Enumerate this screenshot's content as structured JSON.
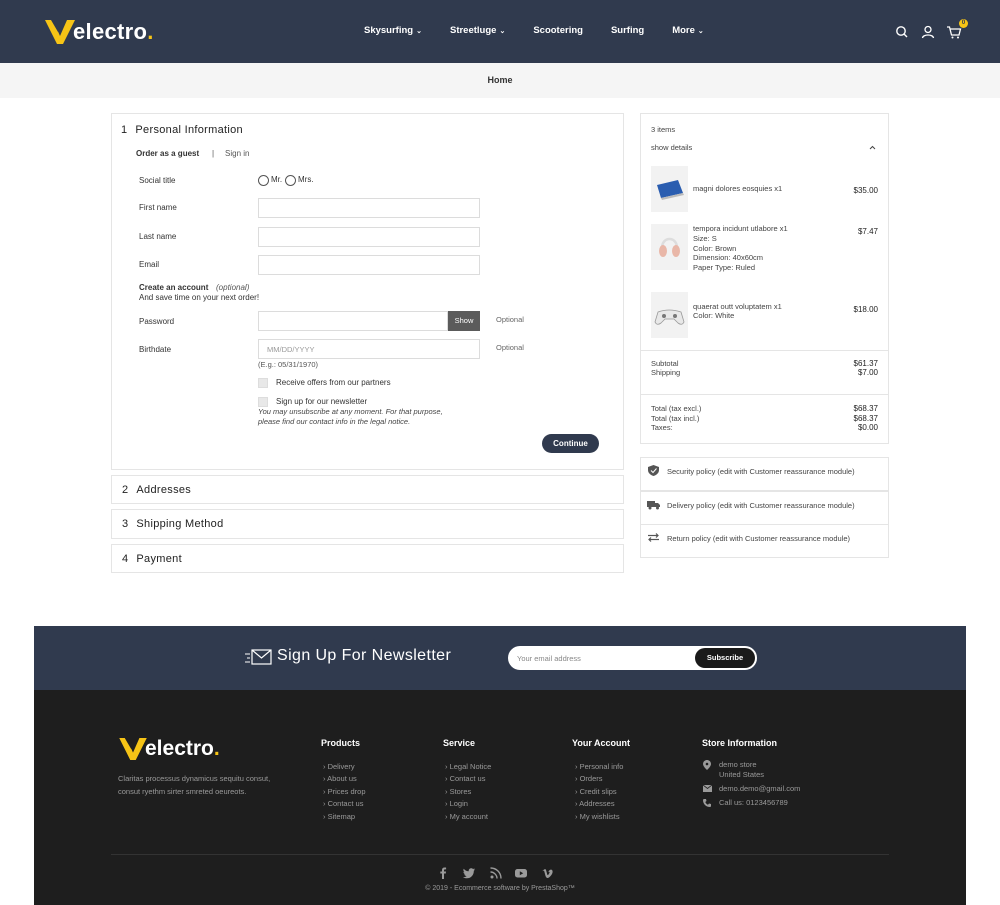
{
  "brand": {
    "name": "electro",
    "dot": "."
  },
  "nav": {
    "items": [
      {
        "label": "Skysurfing",
        "chevron": "⌄"
      },
      {
        "label": "Streetluge",
        "chevron": "⌄"
      },
      {
        "label": "Scootering",
        "chevron": ""
      },
      {
        "label": "Surfing",
        "chevron": ""
      },
      {
        "label": "More",
        "chevron": "⌄"
      }
    ],
    "cart_count": "0"
  },
  "breadcrumb": {
    "home": "Home"
  },
  "checkout": {
    "step1": {
      "number": "1",
      "title": "Personal Information",
      "tab_guest": "Order as a guest",
      "tab_sep": "|",
      "tab_signin": "Sign in",
      "social_title_label": "Social title",
      "mr": "Mr.",
      "mrs": "Mrs.",
      "first_name_label": "First name",
      "last_name_label": "Last name",
      "email_label": "Email",
      "create_account": "Create an account",
      "create_optional": "(optional)",
      "save_time": "And save time on your next order!",
      "password_label": "Password",
      "show_label": "Show",
      "password_optional": "Optional",
      "birthdate_label": "Birthdate",
      "birthdate_placeholder": "MM/DD/YYYY",
      "birthdate_optional": "Optional",
      "birthdate_example": "(E.g.: 05/31/1970)",
      "offers_label": "Receive offers from our partners",
      "newsletter_label": "Sign up for our newsletter",
      "newsletter_note_1": "You may unsubscribe at any moment. For that purpose,",
      "newsletter_note_2": "please find our contact info in the legal notice.",
      "continue": "Continue"
    },
    "step2": {
      "number": "2",
      "title": "Addresses"
    },
    "step3": {
      "number": "3",
      "title": "Shipping Method"
    },
    "step4": {
      "number": "4",
      "title": "Payment"
    }
  },
  "cart": {
    "items_count": "3 items",
    "show_details": "show details",
    "items": [
      {
        "name": "magni dolores eosquies x1",
        "price": "$35.00",
        "attrs": []
      },
      {
        "name": "tempora incidunt utlabore x1",
        "price": "$7.47",
        "attrs": [
          "Size: S",
          "Color: Brown",
          "Dimension: 40x60cm",
          "Paper Type: Ruled"
        ]
      },
      {
        "name": "quaerat outt voluptatem x1",
        "price": "$18.00",
        "attrs": [
          "Color: White"
        ]
      }
    ],
    "subtotal_label": "Subtotal",
    "subtotal_value": "$61.37",
    "shipping_label": "Shipping",
    "shipping_value": "$7.00",
    "total_excl_label": "Total (tax excl.)",
    "total_excl_value": "$68.37",
    "total_incl_label": "Total (tax incl.)",
    "total_incl_value": "$68.37",
    "taxes_label": "Taxes:",
    "taxes_value": "$0.00"
  },
  "reassurance": [
    {
      "icon": "shield-icon",
      "text": "Security policy (edit with Customer reassurance module)"
    },
    {
      "icon": "truck-icon",
      "text": "Delivery policy (edit with Customer reassurance module)"
    },
    {
      "icon": "swap-arrows-icon",
      "text": "Return policy (edit with Customer reassurance module)"
    }
  ],
  "newsletter": {
    "title": "Sign Up For Newsletter",
    "placeholder": "Your email address",
    "button": "Subscribe"
  },
  "footer": {
    "description": "Claritas processus dynamicus sequitu consut, consut ryethm sirter smreted oeureots.",
    "products": {
      "title": "Products",
      "links": [
        "Delivery",
        "About us",
        "Prices drop",
        "Contact us",
        "Sitemap"
      ]
    },
    "service": {
      "title": "Service",
      "links": [
        "Legal Notice",
        "Contact us",
        "Stores",
        "Login",
        "My account"
      ]
    },
    "account": {
      "title": "Your Account",
      "links": [
        "Personal info",
        "Orders",
        "Credit slips",
        "Addresses",
        "My wishlists"
      ]
    },
    "store": {
      "title": "Store Information",
      "address_1": "demo store",
      "address_2": "United States",
      "email": "demo.demo@gmail.com",
      "call": "Call us: 0123456789"
    },
    "social": [
      "facebook-icon",
      "twitter-icon",
      "rss-icon",
      "youtube-icon",
      "vimeo-icon"
    ],
    "copyright": "© 2019 - Ecommerce software by PrestaShop™"
  },
  "colors": {
    "header": "#303a4e",
    "accent": "#f6c416",
    "footer": "#1e1e1e"
  }
}
